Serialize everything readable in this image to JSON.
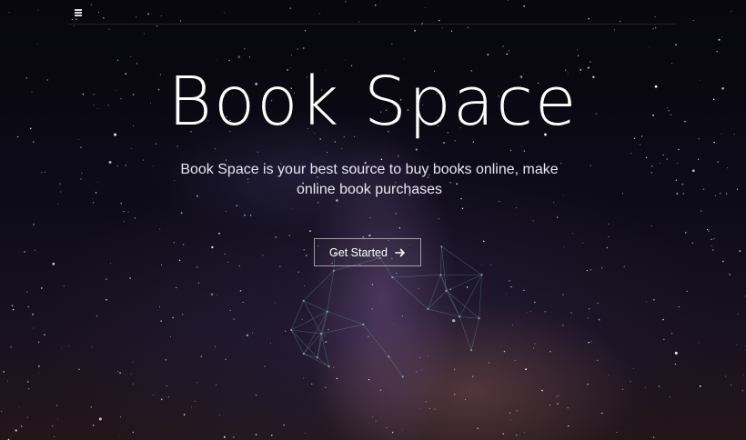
{
  "hero": {
    "title": "Book Space",
    "subtitle": "Book Space is your best source to buy books online, make online book purchases",
    "cta_label": "Get Started"
  },
  "icons": {
    "menu": "hamburger-menu-icon",
    "cta": "arrow-right-icon"
  },
  "colors": {
    "text": "#ffffff",
    "background": "#0b0a12"
  }
}
